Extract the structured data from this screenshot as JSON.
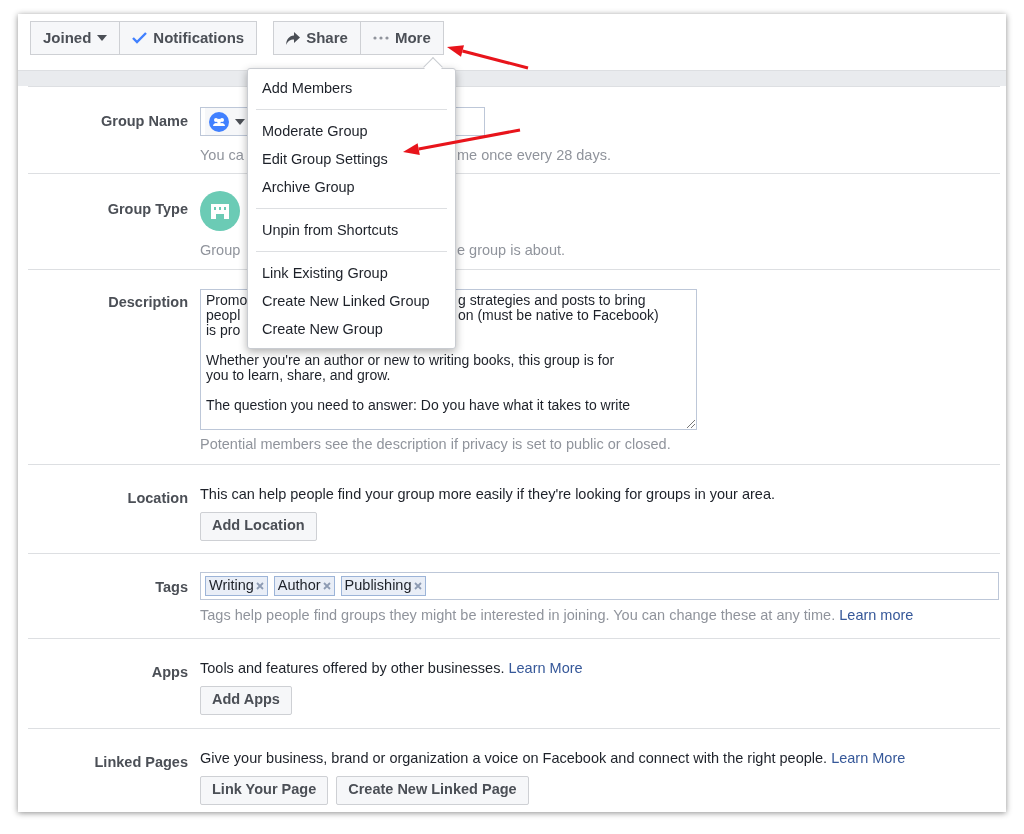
{
  "toolbar": [
    {
      "buttons": [
        {
          "label": "Joined",
          "kind": "caret"
        },
        {
          "label": "Notifications",
          "kind": "check"
        }
      ]
    },
    {
      "buttons": [
        {
          "label": "Share",
          "kind": "share"
        },
        {
          "label": "More",
          "kind": "dots"
        }
      ]
    }
  ],
  "menu": {
    "sections": [
      [
        "Add Members"
      ],
      [
        "Moderate Group",
        "Edit Group Settings",
        "Archive Group"
      ],
      [
        "Unpin from Shortcuts"
      ],
      [
        "Link Existing Group",
        "Create New Linked Group",
        "Create New Group"
      ]
    ]
  },
  "settings": [
    {
      "kind": "name",
      "label": "Group Name",
      "hint": [
        "You ca",
        "me once every 28 days."
      ]
    },
    {
      "kind": "type",
      "label": "Group Type",
      "hint": [
        "Group",
        "e group is about."
      ]
    },
    {
      "kind": "description",
      "label": "Description",
      "paragraphs": [
        [
          [
            "Promo",
            "g strategies and posts to bring"
          ],
          [
            "peopl",
            "on (must be native to Facebook)"
          ],
          [
            "is pro"
          ]
        ],
        [
          [
            "Whether you're an author or new to writing books, this group is for"
          ],
          [
            "you to learn, share, and grow."
          ]
        ],
        [
          [
            "The question you need to answer: Do you have what it takes to write"
          ]
        ]
      ],
      "hint": "Potential members see the description if privacy is set to public or closed."
    },
    {
      "kind": "text_buttons",
      "label": "Location",
      "text": "This can help people find your group more easily if they're looking for groups in your area.",
      "buttons": [
        "Add Location"
      ]
    },
    {
      "kind": "tags",
      "label": "Tags",
      "tags": [
        "Writing",
        "Author",
        "Publishing"
      ],
      "hint": "Tags help people find groups they might be interested in joining. You can change these at any time.",
      "link": "Learn more"
    },
    {
      "kind": "text_buttons",
      "label": "Apps",
      "text": "Tools and features offered by other businesses.",
      "link": "Learn More",
      "buttons": [
        "Add Apps"
      ]
    },
    {
      "kind": "text_buttons",
      "label": "Linked Pages",
      "text": "Give your business, brand or organization a voice on Facebook and connect with the right people.",
      "link": "Learn More",
      "buttons": [
        "Link Your Page",
        "Create New Linked Page"
      ]
    }
  ]
}
